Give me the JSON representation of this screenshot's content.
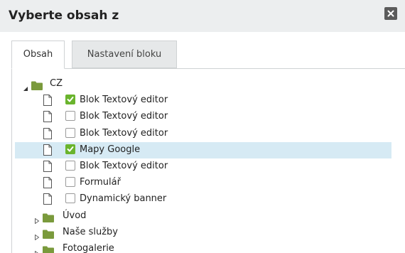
{
  "dialog": {
    "title": "Vyberte obsah z",
    "close_icon": "close-icon"
  },
  "tabs": [
    {
      "label": "Obsah",
      "active": true
    },
    {
      "label": "Nastavení bloku",
      "active": false
    }
  ],
  "tree": {
    "root": {
      "label": "CZ",
      "expanded": true
    },
    "children": [
      {
        "label": "Blok Textový editor",
        "checked": true
      },
      {
        "label": "Blok Textový editor",
        "checked": false
      },
      {
        "label": "Blok Textový editor",
        "checked": false
      },
      {
        "label": "Mapy Google",
        "checked": true,
        "selected": true
      },
      {
        "label": "Blok Textový editor",
        "checked": false
      },
      {
        "label": "Formulář",
        "checked": false
      },
      {
        "label": "Dynamický banner",
        "checked": false
      }
    ],
    "folders": [
      {
        "label": "Úvod",
        "expanded": false
      },
      {
        "label": "Naše služby",
        "expanded": false
      },
      {
        "label": "Fotogalerie",
        "expanded": false
      }
    ]
  },
  "colors": {
    "checkbox_checked": "#6ab42d",
    "folder": "#7a9a3c",
    "selected_row": "#d6eaf4",
    "titlebar": "#eceeef"
  }
}
